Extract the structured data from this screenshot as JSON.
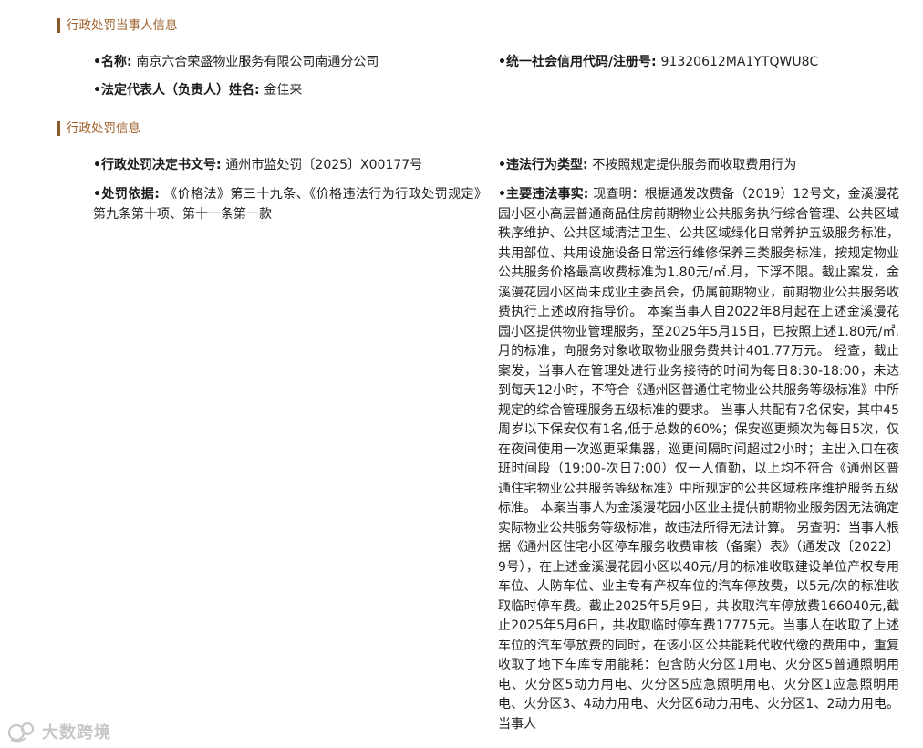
{
  "party_section": {
    "title": "行政处罚当事人信息",
    "name_label": "•名称: ",
    "name_value": "南京六合荣盛物业服务有限公司南通分公司",
    "credit_label": "•统一社会信用代码/注册号: ",
    "credit_value": "91320612MA1YTQWU8C",
    "rep_label": "•法定代表人（负责人）姓名: ",
    "rep_value": "金佳来"
  },
  "penalty_section": {
    "title": "行政处罚信息",
    "doc_no_label": "•行政处罚决定书文号: ",
    "doc_no_value": "通州市监处罚〔2025〕X00177号",
    "violation_type_label": "•违法行为类型: ",
    "violation_type_value": "不按照规定提供服务而收取费用行为",
    "basis_label": "•处罚依据: ",
    "basis_value": "《价格法》第三十九条、《价格违法行为行政处罚规定》第九条第十项、第十一条第一款",
    "facts_label": "•主要违法事实: ",
    "facts_value": "现查明：根据通发改费备（2019）12号文，金溪漫花园小区小高层普通商品住房前期物业公共服务执行综合管理、公共区域秩序维护、公共区域清洁卫生、公共区域绿化日常养护五级服务标准，共用部位、共用设施设备日常运行维修保养三类服务标准，按规定物业公共服务价格最高收费标准为1.80元/㎡.月，下浮不限。截止案发，金溪漫花园小区尚未成业主委员会，仍属前期物业，前期物业公共服务收费执行上述政府指导价。 本案当事人自2022年8月起在上述金溪漫花园小区提供物业管理服务，至2025年5月15日，已按照上述1.80元/㎡.月的标准，向服务对象收取物业服务费共计401.77万元。 经查，截止案发，当事人在管理处进行业务接待的时间为每日8:30-18:00，未达到每天12小时，不符合《通州区普通住宅物业公共服务等级标准》中所规定的综合管理服务五级标准的要求。 当事人共配有7名保安，其中45周岁以下保安仅有1名,低于总数的60%；保安巡更频次为每日5次，仅在夜间使用一次巡更采集器，巡更间隔时间超过2小时；主出入口在夜班时间段（19:00-次日7:00）仅一人值勤，以上均不符合《通州区普通住宅物业公共服务等级标准》中所规定的公共区域秩序维护服务五级标准。 本案当事人为金溪漫花园小区业主提供前期物业服务因无法确定实际物业公共服务等级标准，故违法所得无法计算。 另查明：当事人根据《通州区住宅小区停车服务收费审核（备案）表》（通发改〔2022〕9号），在上述金溪漫花园小区以40元/月的标准收取建设单位产权专用车位、人防车位、业主专有产权车位的汽车停放费，以5元/次的标准收取临时停车费。截止2025年5月9日，共收取汽车停放费166040元,截止2025年5月6日，共收取临时停车费17775元。当事人在收取了上述车位的汽车停放费的同时，在该小区公共能耗代收代缴的费用中，重复收取了地下车库专用能耗：包含防火分区1用电、火分区5普通照明用电、火分区5动力用电、火分区5应急照明用电、火分区1应急照明用电、火分区3、4动力用电、火分区6动力用电、火分区1、2动力用电。 当事人"
  },
  "watermark": {
    "text": "大数跨境"
  }
}
